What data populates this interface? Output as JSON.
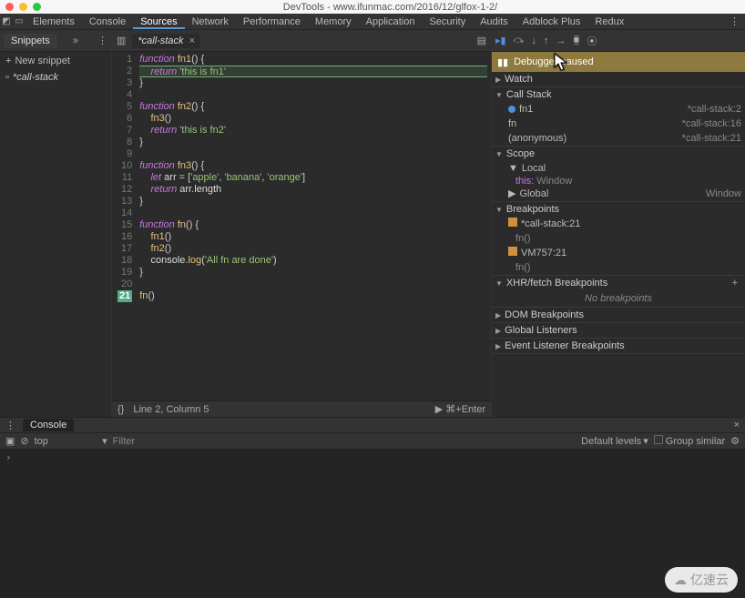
{
  "window": {
    "title": "DevTools - www.ifunmac.com/2016/12/glfox-1-2/"
  },
  "tabs": [
    "Elements",
    "Console",
    "Sources",
    "Network",
    "Performance",
    "Memory",
    "Application",
    "Security",
    "Audits",
    "Adblock Plus",
    "Redux"
  ],
  "active_tab": "Sources",
  "sidebar": {
    "title": "Snippets",
    "new_label": "New snippet",
    "items": [
      {
        "name": "*call-stack"
      }
    ]
  },
  "editor": {
    "tab": {
      "name": "*call-stack"
    },
    "lines": [
      {
        "n": "1",
        "raw": "function fn1() {",
        "tok": [
          [
            "kw",
            "function "
          ],
          [
            "fn",
            "fn1"
          ],
          [
            "op",
            "() {"
          ]
        ]
      },
      {
        "n": "2",
        "raw": "    return 'this is fn1'",
        "cur": true,
        "tok": [
          [
            "op",
            "    "
          ],
          [
            "kw",
            "return "
          ],
          [
            "str",
            "'this is fn1'"
          ]
        ]
      },
      {
        "n": "3",
        "raw": "}",
        "tok": [
          [
            "op",
            "}"
          ]
        ]
      },
      {
        "n": "4",
        "raw": "",
        "tok": []
      },
      {
        "n": "5",
        "raw": "function fn2() {",
        "tok": [
          [
            "kw",
            "function "
          ],
          [
            "fn",
            "fn2"
          ],
          [
            "op",
            "() {"
          ]
        ]
      },
      {
        "n": "6",
        "raw": "    fn3()",
        "tok": [
          [
            "op",
            "    "
          ],
          [
            "fn",
            "fn3"
          ],
          [
            "op",
            "()"
          ]
        ]
      },
      {
        "n": "7",
        "raw": "    return 'this is fn2'",
        "tok": [
          [
            "op",
            "    "
          ],
          [
            "kw",
            "return "
          ],
          [
            "str",
            "'this is fn2'"
          ]
        ]
      },
      {
        "n": "8",
        "raw": "}",
        "tok": [
          [
            "op",
            "}"
          ]
        ]
      },
      {
        "n": "9",
        "raw": "",
        "tok": []
      },
      {
        "n": "10",
        "raw": "function fn3() {",
        "tok": [
          [
            "kw",
            "function "
          ],
          [
            "fn",
            "fn3"
          ],
          [
            "op",
            "() {"
          ]
        ]
      },
      {
        "n": "11",
        "raw": "    let arr = ['apple', 'banana', 'orange']",
        "tok": [
          [
            "op",
            "    "
          ],
          [
            "kw",
            "let "
          ],
          [
            "prop",
            "arr"
          ],
          [
            "op",
            " = ["
          ],
          [
            "str",
            "'apple'"
          ],
          [
            "op",
            ", "
          ],
          [
            "str",
            "'banana'"
          ],
          [
            "op",
            ", "
          ],
          [
            "str",
            "'orange'"
          ],
          [
            "op",
            "]"
          ]
        ]
      },
      {
        "n": "12",
        "raw": "    return arr.length",
        "tok": [
          [
            "op",
            "    "
          ],
          [
            "kw",
            "return "
          ],
          [
            "prop",
            "arr"
          ],
          [
            "op",
            "."
          ],
          [
            "prop",
            "length"
          ]
        ]
      },
      {
        "n": "13",
        "raw": "}",
        "tok": [
          [
            "op",
            "}"
          ]
        ]
      },
      {
        "n": "14",
        "raw": "",
        "tok": []
      },
      {
        "n": "15",
        "raw": "function fn() {",
        "tok": [
          [
            "kw",
            "function "
          ],
          [
            "fn",
            "fn"
          ],
          [
            "op",
            "() {"
          ]
        ]
      },
      {
        "n": "16",
        "raw": "    fn1()",
        "tok": [
          [
            "op",
            "    "
          ],
          [
            "fn",
            "fn1"
          ],
          [
            "op",
            "()"
          ]
        ]
      },
      {
        "n": "17",
        "raw": "    fn2()",
        "tok": [
          [
            "op",
            "    "
          ],
          [
            "fn",
            "fn2"
          ],
          [
            "op",
            "()"
          ]
        ]
      },
      {
        "n": "18",
        "raw": "    console.log('All fn are done')",
        "tok": [
          [
            "op",
            "    "
          ],
          [
            "prop",
            "console"
          ],
          [
            "op",
            "."
          ],
          [
            "fn",
            "log"
          ],
          [
            "op",
            "("
          ],
          [
            "str",
            "'All fn are done'"
          ],
          [
            "op",
            ")"
          ]
        ]
      },
      {
        "n": "19",
        "raw": "}",
        "tok": [
          [
            "op",
            "}"
          ]
        ]
      },
      {
        "n": "20",
        "raw": "",
        "tok": []
      },
      {
        "n": "21",
        "raw": "fn()",
        "hl": true,
        "tok": [
          [
            "fn",
            "fn"
          ],
          [
            "op",
            "()"
          ]
        ]
      }
    ],
    "footer_left": "{}",
    "footer_pos": "Line 2, Column 5",
    "footer_right": "▶ ⌘+Enter"
  },
  "debugger": {
    "status": "Debugger paused",
    "watch": "Watch",
    "callstack": {
      "title": "Call Stack",
      "frames": [
        {
          "name": "fn1",
          "src": "*call-stack:2",
          "bullet": true
        },
        {
          "name": "fn",
          "src": "*call-stack:16"
        },
        {
          "name": "(anonymous)",
          "src": "*call-stack:21"
        }
      ]
    },
    "scope": {
      "title": "Scope",
      "local": {
        "label": "Local",
        "this_label": "this: ",
        "this_val": "Window"
      },
      "global": {
        "label": "Global",
        "val": "Window"
      }
    },
    "breakpoints": {
      "title": "Breakpoints",
      "items": [
        {
          "name": "*call-stack:21",
          "code": "fn()"
        },
        {
          "name": "VM757:21",
          "code": "fn()"
        }
      ]
    },
    "xhr": {
      "title": "XHR/fetch Breakpoints",
      "empty": "No breakpoints"
    },
    "dom": "DOM Breakpoints",
    "global_listeners": "Global Listeners",
    "event_listeners": "Event Listener Breakpoints"
  },
  "console": {
    "tab": "Console",
    "context": "top",
    "filter_placeholder": "Filter",
    "levels": "Default levels",
    "group": "Group similar",
    "prompt": "›"
  },
  "watermark": "亿速云"
}
